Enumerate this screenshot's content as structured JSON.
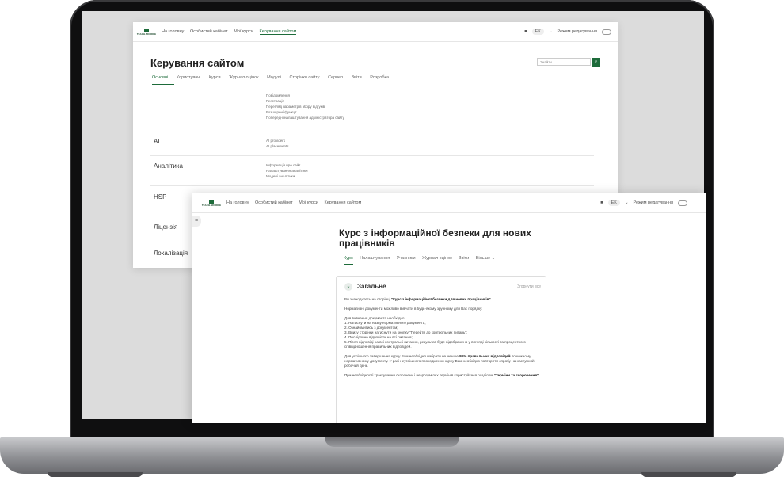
{
  "back_window": {
    "nav": {
      "logo": "TEACH.MOODLE",
      "items": [
        "На головну",
        "Особистий кабінет",
        "Мої курси",
        "Керування сайтом"
      ],
      "lang": "EK",
      "edit_mode": "Режим редагування"
    },
    "title": "Керування сайтом",
    "search_placeholder": "Знайти",
    "tabs": [
      "Основні",
      "Користувачі",
      "Курси",
      "Журнал оцінок",
      "Модулі",
      "Сторінки сайту",
      "Сервер",
      "Звіти",
      "Розробка"
    ],
    "sections": [
      {
        "label": "",
        "links": [
          "Повідомлення",
          "Реєстрація",
          "Перегляд параметрів збору відгуків",
          "Розширені функції",
          "Попередні налаштування адміністратора сайту"
        ]
      },
      {
        "label": "AI",
        "links": [
          "AI providers",
          "AI placements"
        ]
      },
      {
        "label": "Аналітика",
        "links": [
          "Інформація про сайт",
          "Налаштування аналітики",
          "Моделі аналітики"
        ]
      },
      {
        "label": "HSP",
        "links": []
      },
      {
        "label": "Ліцензія",
        "links": []
      },
      {
        "label": "Локалізація",
        "links": []
      }
    ]
  },
  "front_window": {
    "nav": {
      "logo": "TEACH.MOODLE",
      "items": [
        "На головну",
        "Особистий кабінет",
        "Мої курси",
        "Керування сайтом"
      ],
      "lang": "EK",
      "edit_mode": "Режим редагування"
    },
    "title": "Курс з інформаційної безпеки для нових працівників",
    "tabs": [
      "Курс",
      "Налаштування",
      "Учасники",
      "Журнал оцінок",
      "Звіти",
      "Більше ⌄"
    ],
    "section": {
      "title": "Загальне",
      "collapse_label": "Згорнути все",
      "intro_prefix": "Ви знаходитесь на сторінці ",
      "intro_bold": "\"Курс з інформаційної безпеки для нових працівників\".",
      "p2": "Нормативні документи можливо вивчати в будь-якому зручному для Вас порядку.",
      "steps_title": "Для вивчення документа необхідно:",
      "steps": [
        "1. Натиснути на назву нормативного документа;",
        "2. Ознайомитись з документом;",
        "3. Внизу сторінки натиснути на кнопку \"Перейти до контрольних питань\";",
        "4. Послідовно відповісти на всі питання;",
        "5. Після відповіді на всі контрольні питання, результат буде відображено у вигляді кількості та процентного співвідношення правильних відповідей."
      ],
      "p4_prefix": "Для успішного завершення курсу Вам необхідно набрати не менше ",
      "p4_bold": "80% правильних відповідей",
      "p4_suffix": " по кожному нормативному документу. У разі неуспішного проходження курсу Вам необхідно повторити спробу на наступний робочий день.",
      "p5_prefix": "При необхідності трактування скорочень і незрозумілих термінів користуйтеся розділом ",
      "p5_bold": "\"Терміни та скорочення\"."
    }
  }
}
